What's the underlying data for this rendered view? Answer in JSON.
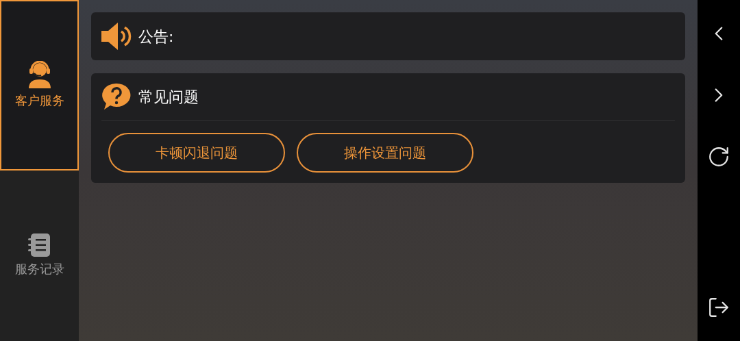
{
  "sidebar": {
    "items": [
      {
        "label": "客户服务",
        "kind": "headset",
        "selected": true
      },
      {
        "label": "服务记录",
        "kind": "notebook",
        "selected": false
      }
    ]
  },
  "announcement": {
    "label": "公告:"
  },
  "faq": {
    "title": "常见问题",
    "buttons": [
      "卡顿闪退问题",
      "操作设置问题"
    ]
  },
  "nav_bar": {
    "buttons": [
      {
        "kind": "back"
      },
      {
        "kind": "forward"
      },
      {
        "kind": "refresh"
      },
      {
        "kind": "exit"
      }
    ]
  }
}
